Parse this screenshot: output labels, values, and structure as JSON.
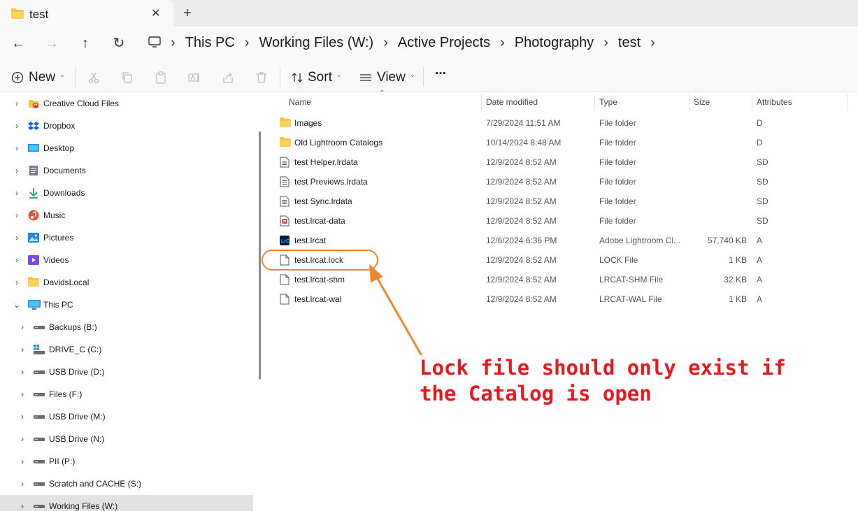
{
  "window": {
    "tab_title": "test",
    "close_tab_symbol": "✕",
    "new_tab_symbol": "+"
  },
  "nav": {
    "back_symbol": "←",
    "forward_symbol": "→",
    "up_symbol": "↑",
    "refresh_symbol": "↻",
    "breadcrumbs": [
      "This PC",
      "Working Files (W:)",
      "Active Projects",
      "Photography",
      "test"
    ],
    "separator": "›"
  },
  "toolbar": {
    "new_label": "New",
    "sort_label": "Sort",
    "view_label": "View",
    "more_symbol": "···"
  },
  "sidebar": {
    "items": [
      {
        "label": "Creative Cloud Files",
        "icon": "creative-cloud-icon",
        "expander": "›"
      },
      {
        "label": "Dropbox",
        "icon": "dropbox-icon",
        "expander": "›"
      },
      {
        "label": "Desktop",
        "icon": "desktop-icon",
        "expander": "›"
      },
      {
        "label": "Documents",
        "icon": "documents-icon",
        "expander": "›"
      },
      {
        "label": "Downloads",
        "icon": "downloads-icon",
        "expander": "›"
      },
      {
        "label": "Music",
        "icon": "music-icon",
        "expander": "›"
      },
      {
        "label": "Pictures",
        "icon": "pictures-icon",
        "expander": "›"
      },
      {
        "label": "Videos",
        "icon": "videos-icon",
        "expander": "›"
      },
      {
        "label": "DavidsLocal",
        "icon": "folder-icon",
        "expander": "›"
      },
      {
        "label": "This PC",
        "icon": "this-pc-icon",
        "expander": "⌄"
      },
      {
        "label": "Backups (B:)",
        "icon": "drive-icon",
        "expander": "›"
      },
      {
        "label": "DRIVE_C (C:)",
        "icon": "windows-drive-icon",
        "expander": "›"
      },
      {
        "label": "USB Drive (D:)",
        "icon": "drive-icon",
        "expander": "›"
      },
      {
        "label": "Files (F:)",
        "icon": "drive-icon",
        "expander": "›"
      },
      {
        "label": "USB Drive (M:)",
        "icon": "drive-icon",
        "expander": "›"
      },
      {
        "label": "USB Drive (N:)",
        "icon": "drive-icon",
        "expander": "›"
      },
      {
        "label": "PII (P:)",
        "icon": "drive-icon",
        "expander": "›"
      },
      {
        "label": "Scratch and CACHE (S:)",
        "icon": "drive-icon",
        "expander": "›"
      },
      {
        "label": "Working Files (W:)",
        "icon": "drive-icon",
        "expander": "›",
        "selected": true
      }
    ]
  },
  "columns": {
    "name": "Name",
    "date": "Date modified",
    "type": "Type",
    "size": "Size",
    "attributes": "Attributes"
  },
  "files": [
    {
      "name": "Images",
      "date": "7/29/2024 11:51 AM",
      "type": "File folder",
      "size": "",
      "attr": "D",
      "icon": "folder-icon"
    },
    {
      "name": "Old Lightroom Catalogs",
      "date": "10/14/2024 8:48 AM",
      "type": "File folder",
      "size": "",
      "attr": "D",
      "icon": "folder-icon"
    },
    {
      "name": "test Helper.lrdata",
      "date": "12/9/2024 8:52 AM",
      "type": "File folder",
      "size": "",
      "attr": "SD",
      "icon": "lrdata-icon"
    },
    {
      "name": "test Previews.lrdata",
      "date": "12/9/2024 8:52 AM",
      "type": "File folder",
      "size": "",
      "attr": "SD",
      "icon": "lrdata-icon"
    },
    {
      "name": "test Sync.lrdata",
      "date": "12/9/2024 8:52 AM",
      "type": "File folder",
      "size": "",
      "attr": "SD",
      "icon": "lrdata-icon"
    },
    {
      "name": "test.lrcat-data",
      "date": "12/9/2024 8:52 AM",
      "type": "File folder",
      "size": "",
      "attr": "SD",
      "icon": "lrcat-data-icon"
    },
    {
      "name": "test.lrcat",
      "date": "12/6/2024 6:36 PM",
      "type": "Adobe Lightroom Cl...",
      "size": "57,740 KB",
      "attr": "A",
      "icon": "lightroom-catalog-icon"
    },
    {
      "name": "test.lrcat.lock",
      "date": "12/9/2024 8:52 AM",
      "type": "LOCK File",
      "size": "1 KB",
      "attr": "A",
      "icon": "file-icon"
    },
    {
      "name": "test.lrcat-shm",
      "date": "12/9/2024 8:52 AM",
      "type": "LRCAT-SHM File",
      "size": "32 KB",
      "attr": "A",
      "icon": "file-icon"
    },
    {
      "name": "test.lrcat-wal",
      "date": "12/9/2024 8:52 AM",
      "type": "LRCAT-WAL File",
      "size": "1 KB",
      "attr": "A",
      "icon": "file-icon"
    }
  ],
  "annotation": {
    "text": "Lock file should only exist if\nthe Catalog is open",
    "text_color": "#e8191c",
    "highlight_color": "#f0862c"
  }
}
